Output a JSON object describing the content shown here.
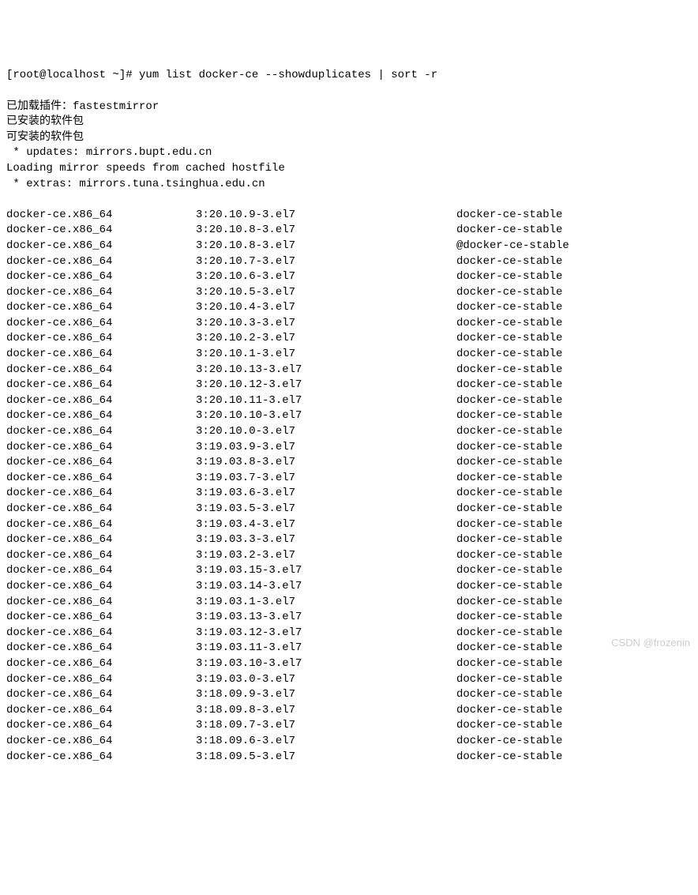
{
  "prompt": "[root@localhost ~]# yum list docker-ce --showduplicates | sort -r",
  "messages": [
    "已加载插件：fastestmirror",
    "已安装的软件包",
    "可安装的软件包",
    " * updates: mirrors.bupt.edu.cn",
    "Loading mirror speeds from cached hostfile",
    " * extras: mirrors.tuna.tsinghua.edu.cn"
  ],
  "packages": [
    {
      "name": "docker-ce.x86_64",
      "version": "3:20.10.9-3.el7",
      "repo": "docker-ce-stable"
    },
    {
      "name": "docker-ce.x86_64",
      "version": "3:20.10.8-3.el7",
      "repo": "docker-ce-stable"
    },
    {
      "name": "docker-ce.x86_64",
      "version": "3:20.10.8-3.el7",
      "repo": "@docker-ce-stable"
    },
    {
      "name": "docker-ce.x86_64",
      "version": "3:20.10.7-3.el7",
      "repo": "docker-ce-stable"
    },
    {
      "name": "docker-ce.x86_64",
      "version": "3:20.10.6-3.el7",
      "repo": "docker-ce-stable"
    },
    {
      "name": "docker-ce.x86_64",
      "version": "3:20.10.5-3.el7",
      "repo": "docker-ce-stable"
    },
    {
      "name": "docker-ce.x86_64",
      "version": "3:20.10.4-3.el7",
      "repo": "docker-ce-stable"
    },
    {
      "name": "docker-ce.x86_64",
      "version": "3:20.10.3-3.el7",
      "repo": "docker-ce-stable"
    },
    {
      "name": "docker-ce.x86_64",
      "version": "3:20.10.2-3.el7",
      "repo": "docker-ce-stable"
    },
    {
      "name": "docker-ce.x86_64",
      "version": "3:20.10.1-3.el7",
      "repo": "docker-ce-stable"
    },
    {
      "name": "docker-ce.x86_64",
      "version": "3:20.10.13-3.el7",
      "repo": "docker-ce-stable"
    },
    {
      "name": "docker-ce.x86_64",
      "version": "3:20.10.12-3.el7",
      "repo": "docker-ce-stable"
    },
    {
      "name": "docker-ce.x86_64",
      "version": "3:20.10.11-3.el7",
      "repo": "docker-ce-stable"
    },
    {
      "name": "docker-ce.x86_64",
      "version": "3:20.10.10-3.el7",
      "repo": "docker-ce-stable"
    },
    {
      "name": "docker-ce.x86_64",
      "version": "3:20.10.0-3.el7",
      "repo": "docker-ce-stable"
    },
    {
      "name": "docker-ce.x86_64",
      "version": "3:19.03.9-3.el7",
      "repo": "docker-ce-stable"
    },
    {
      "name": "docker-ce.x86_64",
      "version": "3:19.03.8-3.el7",
      "repo": "docker-ce-stable"
    },
    {
      "name": "docker-ce.x86_64",
      "version": "3:19.03.7-3.el7",
      "repo": "docker-ce-stable"
    },
    {
      "name": "docker-ce.x86_64",
      "version": "3:19.03.6-3.el7",
      "repo": "docker-ce-stable"
    },
    {
      "name": "docker-ce.x86_64",
      "version": "3:19.03.5-3.el7",
      "repo": "docker-ce-stable"
    },
    {
      "name": "docker-ce.x86_64",
      "version": "3:19.03.4-3.el7",
      "repo": "docker-ce-stable"
    },
    {
      "name": "docker-ce.x86_64",
      "version": "3:19.03.3-3.el7",
      "repo": "docker-ce-stable"
    },
    {
      "name": "docker-ce.x86_64",
      "version": "3:19.03.2-3.el7",
      "repo": "docker-ce-stable"
    },
    {
      "name": "docker-ce.x86_64",
      "version": "3:19.03.15-3.el7",
      "repo": "docker-ce-stable"
    },
    {
      "name": "docker-ce.x86_64",
      "version": "3:19.03.14-3.el7",
      "repo": "docker-ce-stable"
    },
    {
      "name": "docker-ce.x86_64",
      "version": "3:19.03.1-3.el7",
      "repo": "docker-ce-stable"
    },
    {
      "name": "docker-ce.x86_64",
      "version": "3:19.03.13-3.el7",
      "repo": "docker-ce-stable"
    },
    {
      "name": "docker-ce.x86_64",
      "version": "3:19.03.12-3.el7",
      "repo": "docker-ce-stable"
    },
    {
      "name": "docker-ce.x86_64",
      "version": "3:19.03.11-3.el7",
      "repo": "docker-ce-stable"
    },
    {
      "name": "docker-ce.x86_64",
      "version": "3:19.03.10-3.el7",
      "repo": "docker-ce-stable"
    },
    {
      "name": "docker-ce.x86_64",
      "version": "3:19.03.0-3.el7",
      "repo": "docker-ce-stable"
    },
    {
      "name": "docker-ce.x86_64",
      "version": "3:18.09.9-3.el7",
      "repo": "docker-ce-stable"
    },
    {
      "name": "docker-ce.x86_64",
      "version": "3:18.09.8-3.el7",
      "repo": "docker-ce-stable"
    },
    {
      "name": "docker-ce.x86_64",
      "version": "3:18.09.7-3.el7",
      "repo": "docker-ce-stable"
    },
    {
      "name": "docker-ce.x86_64",
      "version": "3:18.09.6-3.el7",
      "repo": "docker-ce-stable"
    },
    {
      "name": "docker-ce.x86_64",
      "version": "3:18.09.5-3.el7",
      "repo": "docker-ce-stable"
    }
  ],
  "watermark": "CSDN @frozenin"
}
